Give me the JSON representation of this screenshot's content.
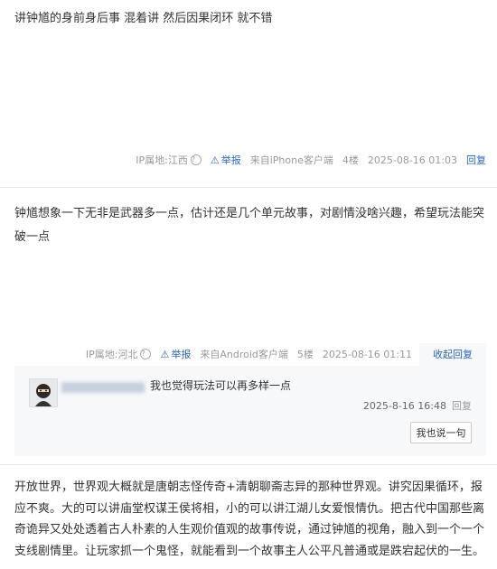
{
  "posts": [
    {
      "text": "讲钟馗的身前身后事 混着讲 然后因果闭环 就不错",
      "ip": "IP属地:江西",
      "report": "举报",
      "source": "来自iPhone客户端",
      "floor": "4楼",
      "time": "2025-08-16 01:03",
      "reply": "回复"
    },
    {
      "text": "钟馗想象一下无非是武器多一点，估计还是几个单元故事，对剧情没啥兴趣，希望玩法能突破一点",
      "ip": "IP属地:河北",
      "report": "举报",
      "source": "来自Android客户端",
      "floor": "5楼",
      "time": "2025-08-16 01:11",
      "collapse": "收起回复",
      "sub_reply": {
        "text": "我也觉得玩法可以再多样一点",
        "time": "2025-8-16 16:48",
        "reply": "回复",
        "say_button": "我也说一句"
      }
    },
    {
      "text": "开放世界，世界观大概就是唐朝志怪传奇+清朝聊斋志异的那种世界观。讲究因果循环，报应不爽。大的可以讲庙堂权谋王侯将相，小的可以讲江湖儿女爱恨情仇。把古代中国那些离奇诡异又处处透着古人朴素的人生观价值观的故事传说，通过钟馗的视角，融入到一个一个支线剧情里。让玩家抓一个鬼怪，就能看到一个故事主人公平凡普通或是跌宕起伏的一生。"
    }
  ],
  "icons": {
    "help": "question-circle-icon",
    "report": "warning-triangle-icon",
    "avatar": "ninja-avatar"
  },
  "colors": {
    "link": "#2d64b3",
    "meta": "#999999",
    "subbg": "#f7f8fa"
  }
}
